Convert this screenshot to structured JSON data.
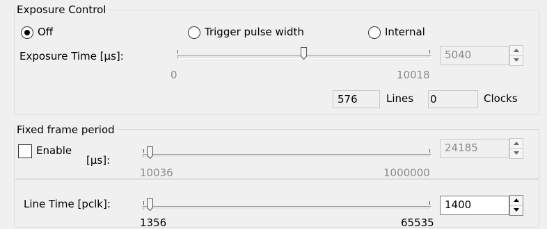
{
  "exposure_control": {
    "legend": "Exposure Control",
    "radios": [
      {
        "label": "Off",
        "checked": true
      },
      {
        "label": "Trigger pulse width",
        "checked": false
      },
      {
        "label": "Internal",
        "checked": false
      }
    ],
    "time_label": "Exposure Time [µs]:",
    "slider": {
      "min": "0",
      "max": "10018",
      "value": "5040"
    },
    "lines_value": "576",
    "lines_label": "Lines",
    "clocks_value": "0",
    "clocks_label": "Clocks"
  },
  "fixed_frame": {
    "legend": "Fixed frame period",
    "enable_label": "Enable",
    "unit_label": "[µs]:",
    "slider": {
      "min": "10036",
      "max": "1000000",
      "value": "24185"
    }
  },
  "line_time": {
    "label": "Line Time [pclk]:",
    "slider": {
      "min": "1356",
      "max": "65535",
      "value": "1400"
    }
  }
}
